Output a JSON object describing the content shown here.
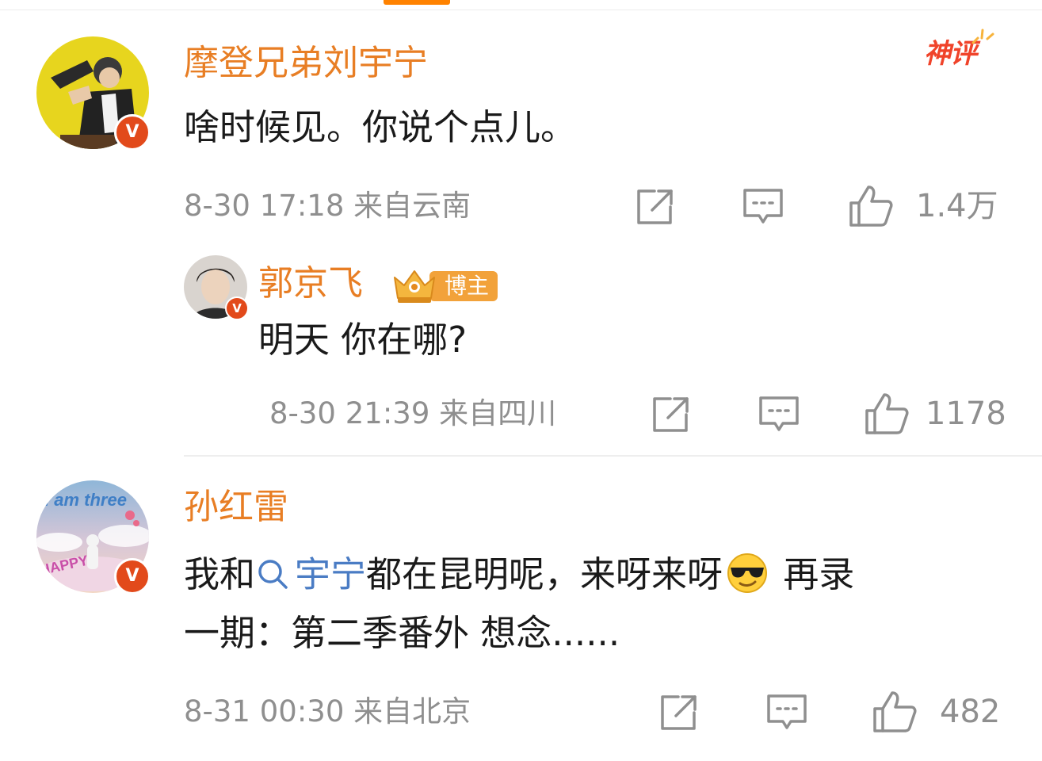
{
  "comments": [
    {
      "username": "摩登兄弟刘宇宁",
      "hot_label": "神评",
      "content": "啥时候见。你说个点儿。",
      "meta": "8-30 17:18 来自云南",
      "likes": "1.4万",
      "verified_mark": "V"
    },
    {
      "username": "郭京飞",
      "role_badge": "博主",
      "content": "明天 你在哪?",
      "meta": "8-30 21:39 来自四川",
      "likes": "1178",
      "verified_mark": "V"
    },
    {
      "username": "孙红雷",
      "avatar_text": "I am three",
      "avatar_text_2": "HAPPY",
      "content_prefix": "我和",
      "mention": "宇宁",
      "content_middle": "都在昆明呢，来呀来呀",
      "content_after_emoji": " 再录",
      "content_line2": "一期：第二季番外 想念......",
      "meta": "8-31 00:30 来自北京",
      "likes": "482",
      "verified_mark": "V"
    }
  ],
  "icons": {
    "share": "share-icon",
    "comment": "comment-icon",
    "like": "thumbs-up-icon",
    "mention": "search-icon",
    "emoji": "sunglasses-emoji-icon"
  },
  "colors": {
    "username": "#e87e24",
    "mention": "#4a7cc4",
    "meta": "#8f8f8f",
    "hot_label": "#f0432a",
    "verified": "#e24a1b",
    "blogger_badge": "#f2a23a",
    "tab_indicator": "#ff8200"
  }
}
